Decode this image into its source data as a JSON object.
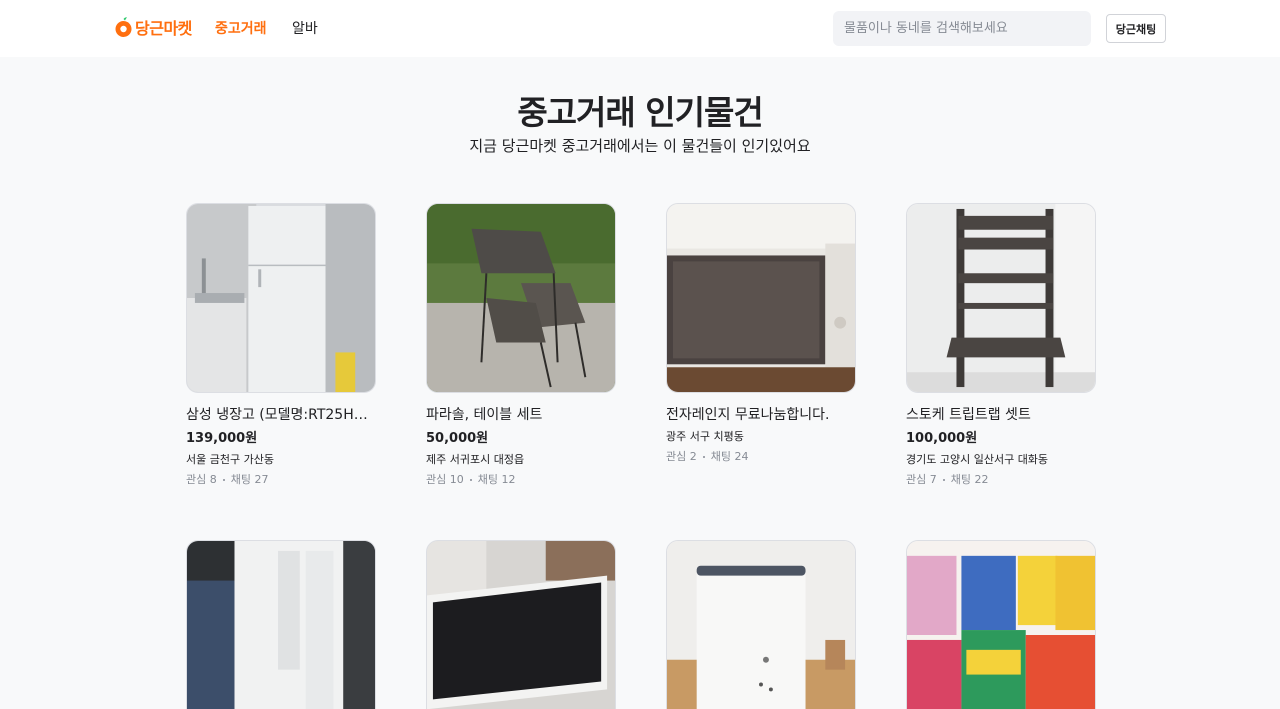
{
  "header": {
    "logo_text": "당근마켓",
    "nav": [
      "중고거래",
      "알바"
    ],
    "search_placeholder": "물품이나 동네를 검색해보세요",
    "chat_button": "당근채팅",
    "accent_color": "#ff6f0f"
  },
  "hero": {
    "title": "중고거래 인기물건",
    "subtitle": "지금 당근마켓 중고거래에서는 이 물건들이 인기있어요"
  },
  "products": [
    {
      "title": "삼성 냉장고 (모델명:RT25HA...",
      "price": "139,000원",
      "region": "서울 금천구 가산동",
      "likes": "관심 8",
      "chats": "채팅 27",
      "image": "refrigerator"
    },
    {
      "title": "파라솔, 테이블 세트",
      "price": "50,000원",
      "region": "제주 서귀포시 대정읍",
      "likes": "관심 10",
      "chats": "채팅 12",
      "image": "outdoor-table-set"
    },
    {
      "title": "전자레인지 무료나눔합니다.",
      "price": "",
      "region": "광주 서구 치평동",
      "likes": "관심 2",
      "chats": "채팅 24",
      "image": "microwave"
    },
    {
      "title": "스토케 트립트랩 셋트",
      "price": "100,000원",
      "region": "경기도 고양시 일산서구 대화동",
      "likes": "관심 7",
      "chats": "채팅 22",
      "image": "high-chair"
    },
    {
      "title": "",
      "price": "",
      "region": "",
      "likes": "",
      "chats": "",
      "image": "air-conditioner"
    },
    {
      "title": "",
      "price": "",
      "region": "",
      "likes": "",
      "chats": "",
      "image": "monitor"
    },
    {
      "title": "",
      "price": "",
      "region": "",
      "likes": "",
      "chats": "",
      "image": "humidifier"
    },
    {
      "title": "",
      "price": "",
      "region": "",
      "likes": "",
      "chats": "",
      "image": "snack-packages"
    }
  ]
}
